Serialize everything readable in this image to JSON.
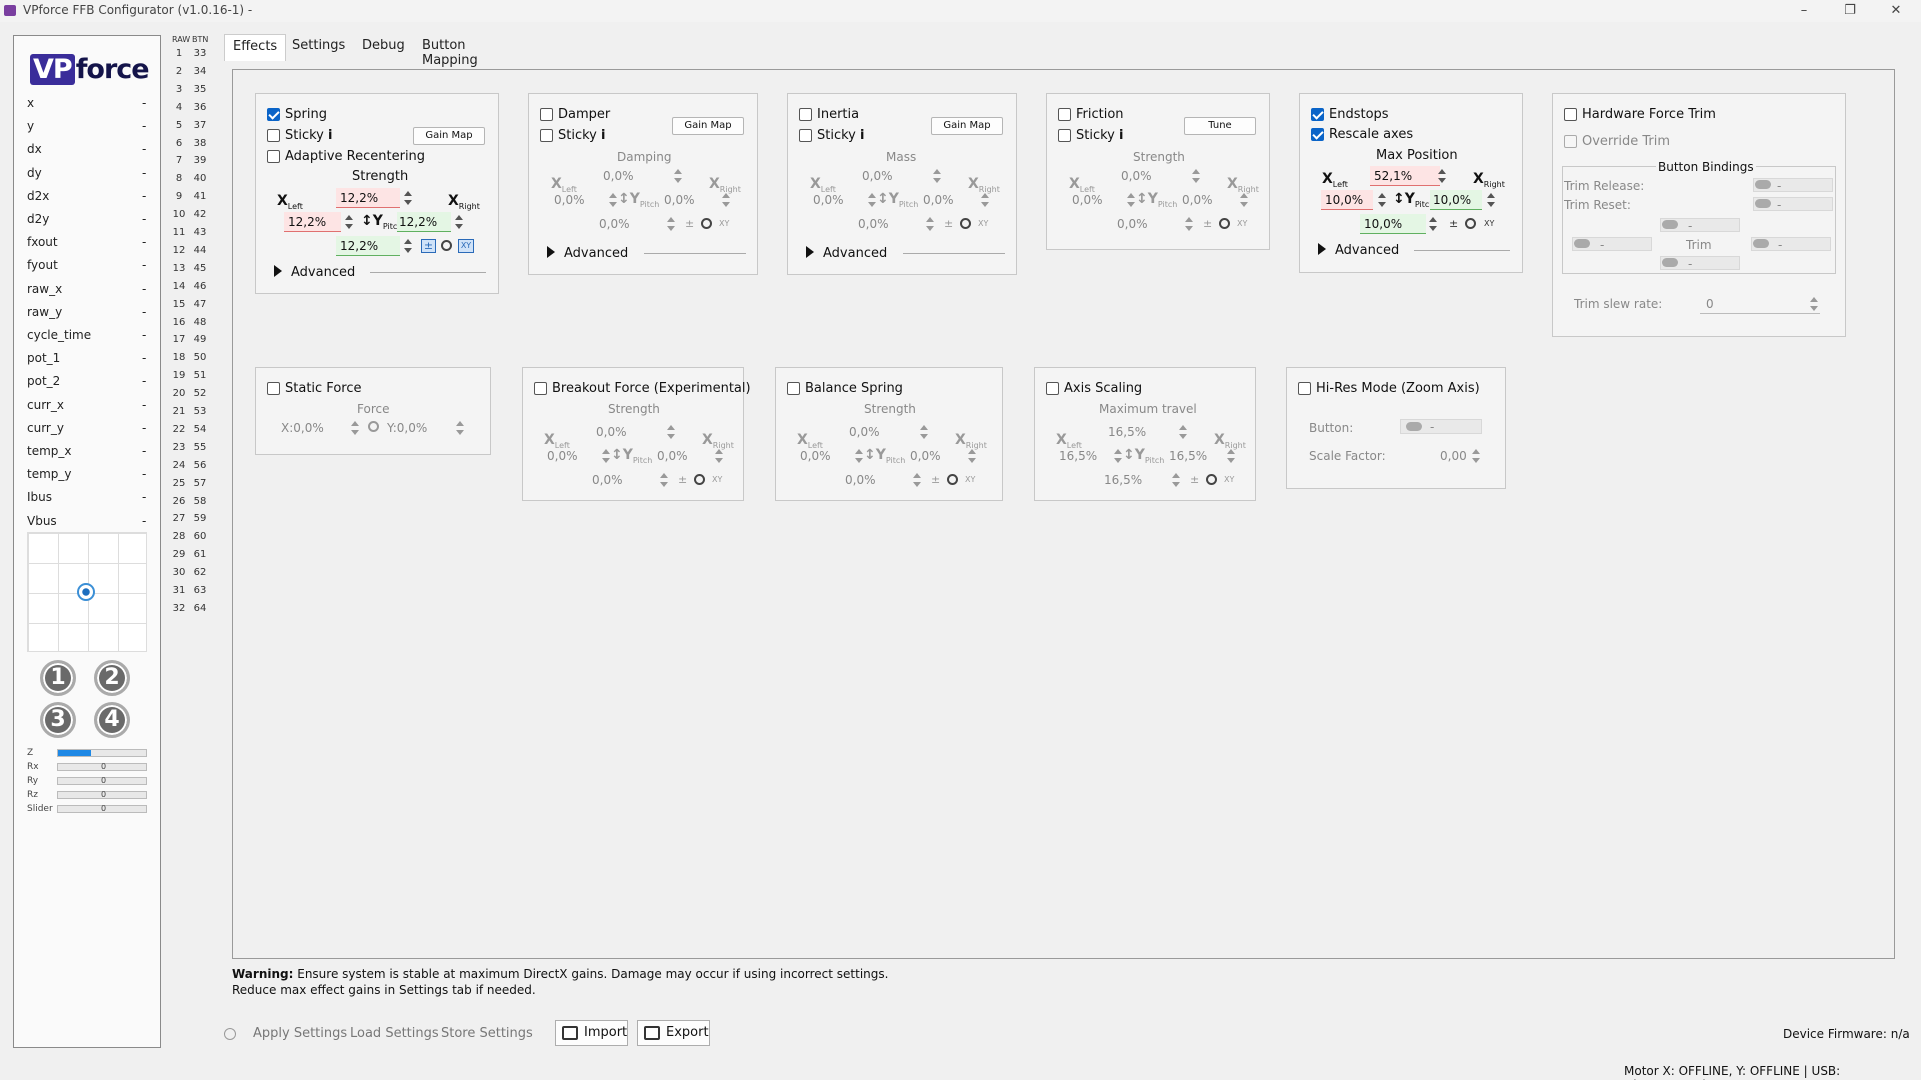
{
  "window": {
    "title": "VPforce FFB Configurator (v1.0.16-1) -",
    "minimize": "–",
    "maximize": "❐",
    "close": "✕"
  },
  "logo": {
    "vp": "VP",
    "rest": "force"
  },
  "axes": [
    "x",
    "y",
    "dx",
    "dy",
    "d2x",
    "d2y",
    "fxout",
    "fyout",
    "raw_x",
    "raw_y",
    "cycle_time",
    "pot_1",
    "pot_2",
    "curr_x",
    "curr_y",
    "temp_x",
    "temp_y",
    "Ibus",
    "Vbus"
  ],
  "axis_value": "-",
  "pov_buttons": [
    "1",
    "2",
    "3",
    "4"
  ],
  "bars": [
    {
      "label": "Z",
      "value": "",
      "fill": 0.38
    },
    {
      "label": "Rx",
      "value": "0",
      "fill": 0
    },
    {
      "label": "Ry",
      "value": "0",
      "fill": 0
    },
    {
      "label": "Rz",
      "value": "0",
      "fill": 0
    },
    {
      "label": "Slider",
      "value": "0",
      "fill": 0
    }
  ],
  "raw_header": "RAW",
  "btn_header": "BTN",
  "raw_numbers": [
    "1",
    "2",
    "3",
    "4",
    "5",
    "6",
    "7",
    "8",
    "9",
    "10",
    "11",
    "12",
    "13",
    "14",
    "15",
    "16",
    "17",
    "18",
    "19",
    "20",
    "21",
    "22",
    "23",
    "24",
    "25",
    "26",
    "27",
    "28",
    "29",
    "30",
    "31",
    "32"
  ],
  "btn_numbers": [
    "33",
    "34",
    "35",
    "36",
    "37",
    "38",
    "39",
    "40",
    "41",
    "42",
    "43",
    "44",
    "45",
    "46",
    "47",
    "48",
    "49",
    "50",
    "51",
    "52",
    "53",
    "54",
    "55",
    "56",
    "57",
    "58",
    "59",
    "60",
    "61",
    "62",
    "63",
    "64"
  ],
  "tabs": [
    "Effects",
    "Settings",
    "Debug",
    "Button Mapping"
  ],
  "spring": {
    "label": "Spring",
    "sticky": "Sticky",
    "info": "i",
    "gain_map": "Gain Map",
    "adaptive": "Adaptive Recentering",
    "strength": "Strength",
    "top": "12,2%",
    "left": "12,2%",
    "right": "12,2%",
    "center": "12,2%",
    "advanced": "Advanced"
  },
  "damper": {
    "label": "Damper",
    "sticky": "Sticky",
    "gain_map": "Gain Map",
    "section": "Damping",
    "top": "0,0%",
    "left": "0,0%",
    "right": "0,0%",
    "center": "0,0%",
    "advanced": "Advanced"
  },
  "inertia": {
    "label": "Inertia",
    "sticky": "Sticky",
    "gain_map": "Gain Map",
    "section": "Mass",
    "top": "0,0%",
    "left": "0,0%",
    "right": "0,0%",
    "center": "0,0%",
    "advanced": "Advanced"
  },
  "friction": {
    "label": "Friction",
    "sticky": "Sticky",
    "tune": "Tune",
    "section": "Strength",
    "top": "0,0%",
    "left": "0,0%",
    "right": "0,0%",
    "center": "0,0%"
  },
  "endstops": {
    "label": "Endstops",
    "rescale": "Rescale axes",
    "section": "Max Position",
    "top": "52,1%",
    "left": "10,0%",
    "right": "10,0%",
    "center": "10,0%",
    "advanced": "Advanced"
  },
  "trim": {
    "label": "Hardware Force Trim",
    "override": "Override Trim",
    "bindings": "Button Bindings",
    "release": "Trim Release:",
    "reset": "Trim Reset:",
    "trim": "Trim",
    "dash": "-",
    "slew": "Trim slew rate:",
    "slew_value": "0"
  },
  "static_force": {
    "label": "Static Force",
    "section": "Force",
    "x": "X:0,0%",
    "y": "Y:0,0%"
  },
  "breakout": {
    "label": "Breakout Force (Experimental)",
    "section": "Strength",
    "top": "0,0%",
    "left": "0,0%",
    "right": "0,0%",
    "center": "0,0%"
  },
  "balance": {
    "label": "Balance Spring",
    "section": "Strength",
    "top": "0,0%",
    "left": "0,0%",
    "right": "0,0%",
    "center": "0,0%"
  },
  "axis_scaling": {
    "label": "Axis Scaling",
    "section": "Maximum travel",
    "top": "16,5%",
    "left": "16,5%",
    "right": "16,5%",
    "center": "16,5%"
  },
  "hires": {
    "label": "Hi-Res Mode (Zoom Axis)",
    "button": "Button:",
    "button_value": "-",
    "scale": "Scale Factor:",
    "scale_value": "0,00"
  },
  "labels": {
    "x": "X",
    "y": "Y",
    "left": "Left",
    "right": "Right",
    "pitch": "Pitch",
    "pm": "±",
    "xy": "XY"
  },
  "warning": {
    "bold": "Warning:",
    "line1": " Ensure system is stable at maximum DirectX gains. Damage may occur if using incorrect settings.",
    "line2": "Reduce max effect gains in Settings tab if needed."
  },
  "bottom": {
    "apply": "Apply Settings",
    "load": "Load Settings",
    "store": "Store Settings",
    "import": "Import",
    "export": "Export",
    "firmware": "Device Firmware:  n/a",
    "status": "Motor X: OFFLINE, Y: OFFLINE | USB: Disconnected"
  }
}
